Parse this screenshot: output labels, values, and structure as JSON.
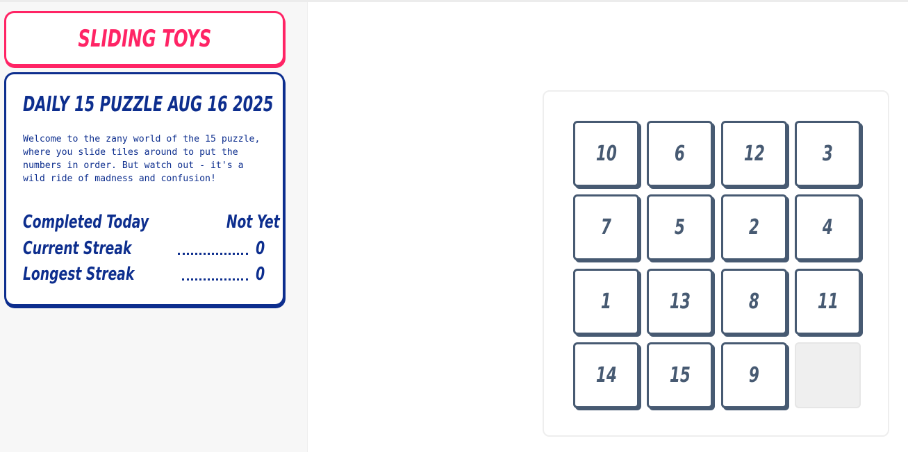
{
  "sidebar": {
    "brand": "SLIDING TOYS",
    "puzzle_title": "DAILY 15 PUZZLE AUG 16 2025",
    "intro": "Welcome to the zany world of the 15 puzzle, where you slide tiles around to put the numbers in order. But watch out - it's a wild ride of madness and confusion!",
    "stats": [
      {
        "label": "Completed Today",
        "value": "Not Yet"
      },
      {
        "label": "Current Streak",
        "value": "0"
      },
      {
        "label": "Longest Streak",
        "value": "0"
      }
    ]
  },
  "board": {
    "tiles": [
      "10",
      "6",
      "12",
      "3",
      "7",
      "5",
      "2",
      "4",
      "1",
      "13",
      "8",
      "11",
      "14",
      "15",
      "9",
      ""
    ]
  },
  "colors": {
    "brand": "#ff2465",
    "navy": "#0d2e8e",
    "tile": "#475a72",
    "empty_tile": "#efefef"
  }
}
